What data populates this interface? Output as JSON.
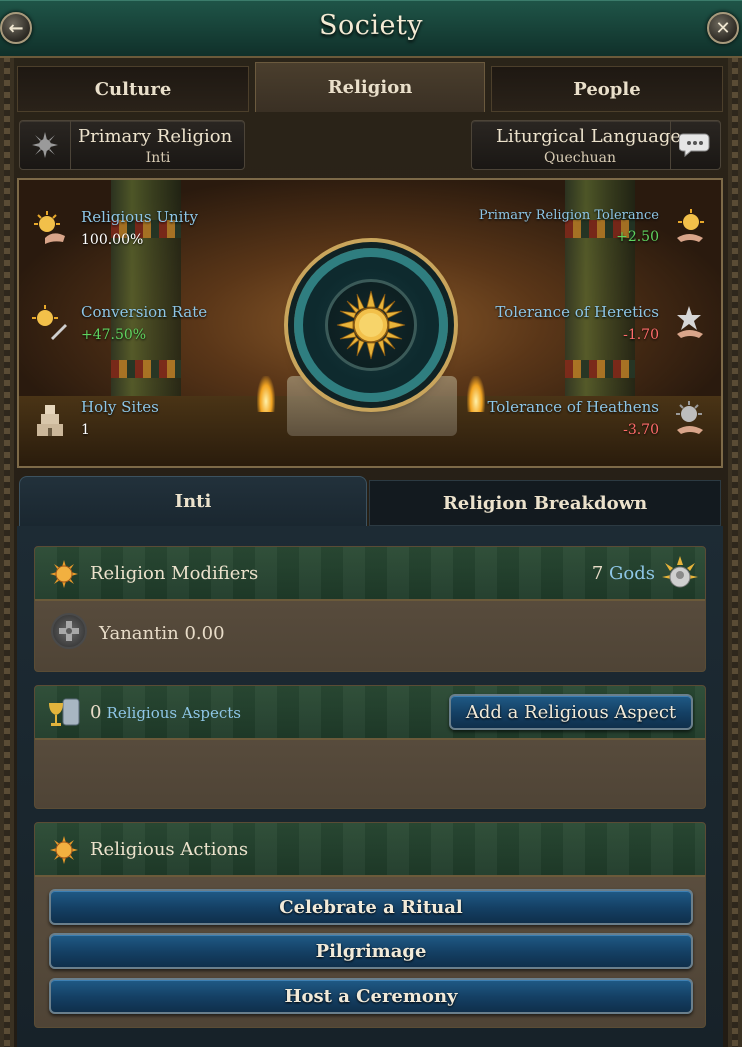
{
  "header": {
    "title": "Society",
    "back_icon": "arrow-left-icon",
    "close_icon": "close-x-icon"
  },
  "top_tabs": [
    {
      "label": "Culture",
      "active": false
    },
    {
      "label": "Religion",
      "active": true
    },
    {
      "label": "People",
      "active": false
    }
  ],
  "primary_religion": {
    "label": "Primary Religion",
    "value": "Inti",
    "icon": "sun-disc-icon"
  },
  "liturgical_language": {
    "label": "Liturgical Language",
    "value": "Quechuan",
    "icon": "speech-bubble-icon"
  },
  "stats_left": [
    {
      "label": "Religious Unity",
      "value": "100.00%",
      "value_color": "#ffffff",
      "icon": "sun-hand-icon"
    },
    {
      "label": "Conversion Rate",
      "value": "+47.50%",
      "value_color": "#5fd35f",
      "icon": "sun-quill-icon"
    },
    {
      "label": "Holy Sites",
      "value": "1",
      "value_color": "#ffffff",
      "icon": "temple-icon"
    }
  ],
  "stats_right": [
    {
      "label": "Primary Religion Tolerance",
      "value": "+2.50",
      "value_color": "#5fd35f",
      "icon": "sun-handshake-icon"
    },
    {
      "label": "Tolerance of Heretics",
      "value": "-1.70",
      "value_color": "#ff6b6b",
      "icon": "star-handshake-icon"
    },
    {
      "label": "Tolerance of Heathens",
      "value": "-3.70",
      "value_color": "#ff6b6b",
      "icon": "spiked-handshake-icon"
    }
  ],
  "banner": {
    "emblem_icon": "inti-sun-icon"
  },
  "sub_tabs": [
    {
      "label": "Inti",
      "active": true
    },
    {
      "label": "Religion Breakdown",
      "active": false
    }
  ],
  "modifiers_panel": {
    "title": "Religion Modifiers",
    "gods_count": "7",
    "gods_label": "Gods",
    "gods_icon": "deity-icon",
    "items": [
      {
        "name": "Yanantin",
        "value": "0.00",
        "icon": "yanantin-emblem-icon"
      }
    ]
  },
  "aspects_panel": {
    "count": "0",
    "label": "Religious Aspects",
    "icon": "chalice-scroll-icon",
    "add_button": "Add a Religious Aspect"
  },
  "actions_panel": {
    "title": "Religious Actions",
    "buttons": [
      "Celebrate a Ritual",
      "Pilgrimage",
      "Host a Ceremony"
    ]
  },
  "colors": {
    "positive": "#5fd35f",
    "negative": "#ff6b6b",
    "link": "#8ec6e6",
    "header_green": "#1f5548",
    "button_blue": "#1f5a86"
  }
}
